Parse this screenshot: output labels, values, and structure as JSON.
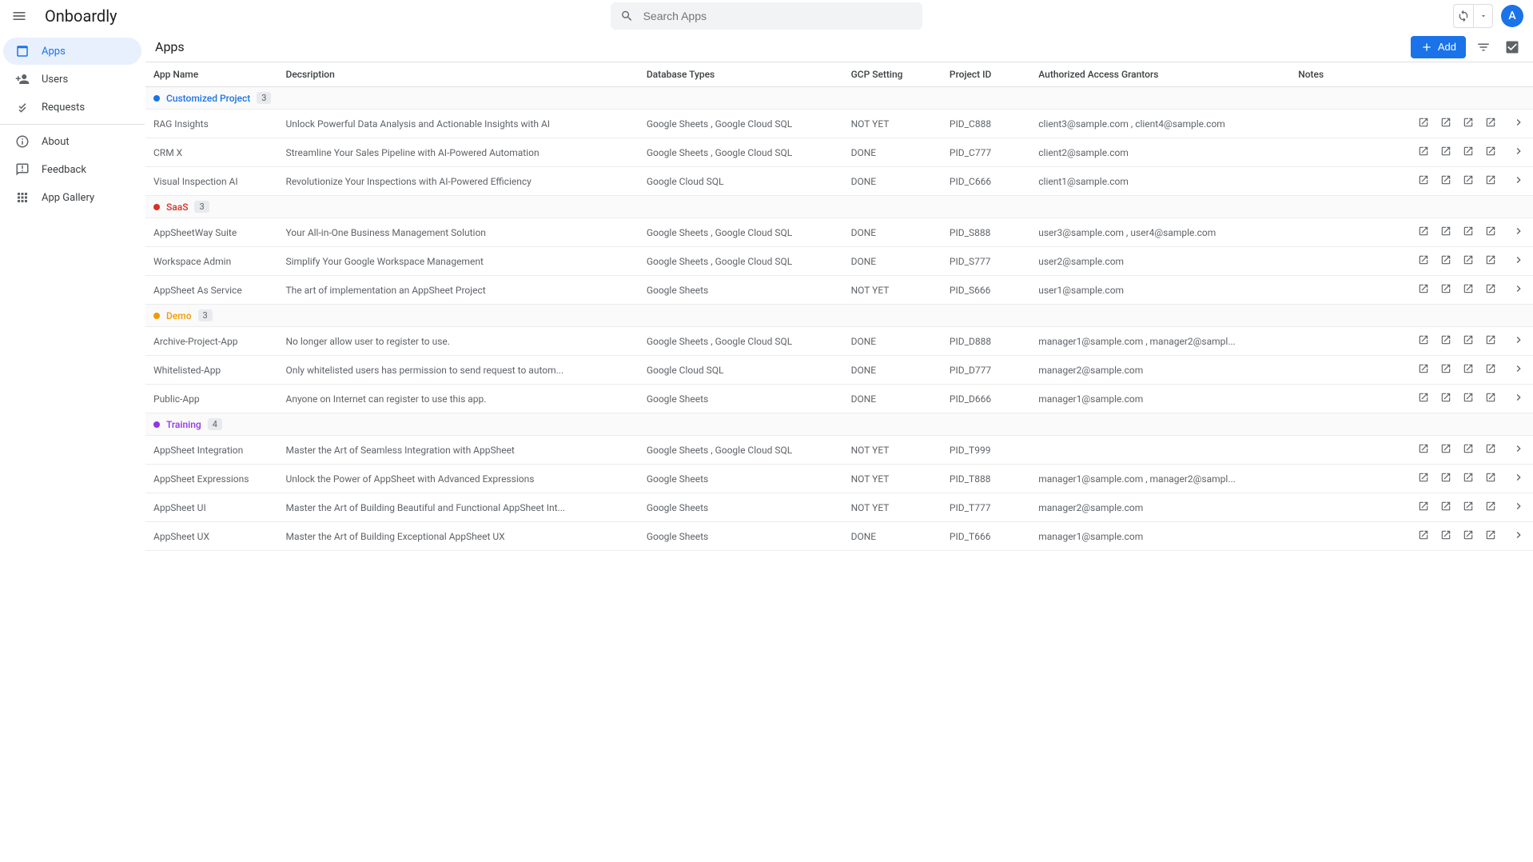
{
  "app_title": "Onboardly",
  "search_placeholder": "Search Apps",
  "avatar_initial": "A",
  "sidebar": [
    {
      "id": "apps",
      "label": "Apps",
      "active": true
    },
    {
      "id": "users",
      "label": "Users",
      "active": false
    },
    {
      "id": "requests",
      "label": "Requests",
      "active": false
    },
    {
      "id": "_divider"
    },
    {
      "id": "about",
      "label": "About",
      "active": false
    },
    {
      "id": "feedback",
      "label": "Feedback",
      "active": false
    },
    {
      "id": "app-gallery",
      "label": "App Gallery",
      "active": false
    }
  ],
  "page_title": "Apps",
  "add_button_label": "Add",
  "columns": {
    "app_name": "App Name",
    "description": "Decsription",
    "database_types": "Database Types",
    "gcp_setting": "GCP Setting",
    "project_id": "Project ID",
    "grantors": "Authorized Access Grantors",
    "notes": "Notes"
  },
  "groups": [
    {
      "label": "Customized Project",
      "color": "#1a73e8",
      "text_color": "#1a73e8",
      "count": "3",
      "rows": [
        {
          "name": "RAG Insights",
          "desc": "Unlock Powerful Data Analysis and Actionable Insights with AI",
          "db": "Google Sheets , Google Cloud SQL",
          "gcp": "NOT YET",
          "pid": "PID_C888",
          "grantors": "client3@sample.com , client4@sample.com"
        },
        {
          "name": "CRM X",
          "desc": "Streamline Your Sales Pipeline with AI-Powered Automation",
          "db": "Google Sheets , Google Cloud SQL",
          "gcp": "DONE",
          "pid": "PID_C777",
          "grantors": "client2@sample.com"
        },
        {
          "name": "Visual Inspection AI",
          "desc": "Revolutionize Your Inspections with AI-Powered Efficiency",
          "db": "Google Cloud SQL",
          "gcp": "DONE",
          "pid": "PID_C666",
          "grantors": "client1@sample.com"
        }
      ]
    },
    {
      "label": "SaaS",
      "color": "#d93025",
      "text_color": "#d93025",
      "count": "3",
      "rows": [
        {
          "name": "AppSheetWay Suite",
          "desc": "Your All-in-One Business Management Solution",
          "db": "Google Sheets , Google Cloud SQL",
          "gcp": "DONE",
          "pid": "PID_S888",
          "grantors": "user3@sample.com , user4@sample.com"
        },
        {
          "name": "Workspace Admin",
          "desc": "Simplify Your Google Workspace Management",
          "db": "Google Sheets , Google Cloud SQL",
          "gcp": "DONE",
          "pid": "PID_S777",
          "grantors": "user2@sample.com"
        },
        {
          "name": "AppSheet As Service",
          "desc": "The art of implementation an AppSheet Project",
          "db": "Google Sheets",
          "gcp": "NOT YET",
          "pid": "PID_S666",
          "grantors": "user1@sample.com"
        }
      ]
    },
    {
      "label": "Demo",
      "color": "#f29900",
      "text_color": "#f29900",
      "count": "3",
      "rows": [
        {
          "name": "Archive-Project-App",
          "desc": "No longer allow user to register to use.",
          "db": "Google Sheets , Google Cloud SQL",
          "gcp": "DONE",
          "pid": "PID_D888",
          "grantors": "manager1@sample.com , manager2@sampl..."
        },
        {
          "name": "Whitelisted-App",
          "desc": "Only whitelisted users has permission to send request to autom...",
          "db": "Google Cloud SQL",
          "gcp": "DONE",
          "pid": "PID_D777",
          "grantors": "manager2@sample.com"
        },
        {
          "name": "Public-App",
          "desc": "Anyone on Internet can register to use this app.",
          "db": "Google Sheets",
          "gcp": "DONE",
          "pid": "PID_D666",
          "grantors": "manager1@sample.com"
        }
      ]
    },
    {
      "label": "Training",
      "color": "#9334e6",
      "text_color": "#9334e6",
      "count": "4",
      "rows": [
        {
          "name": "AppSheet Integration",
          "desc": "Master the Art of Seamless Integration with AppSheet",
          "db": "Google Sheets , Google Cloud SQL",
          "gcp": "NOT YET",
          "pid": "PID_T999",
          "grantors": ""
        },
        {
          "name": "AppSheet Expressions",
          "desc": "Unlock the Power of AppSheet with Advanced Expressions",
          "db": "Google Sheets",
          "gcp": "NOT YET",
          "pid": "PID_T888",
          "grantors": "manager1@sample.com , manager2@sampl..."
        },
        {
          "name": "AppSheet UI",
          "desc": "Master the Art of Building Beautiful and Functional AppSheet Int...",
          "db": "Google Sheets",
          "gcp": "NOT YET",
          "pid": "PID_T777",
          "grantors": "manager2@sample.com"
        },
        {
          "name": "AppSheet UX",
          "desc": "Master the Art of Building Exceptional AppSheet UX",
          "db": "Google Sheets",
          "gcp": "DONE",
          "pid": "PID_T666",
          "grantors": "manager1@sample.com"
        }
      ]
    }
  ]
}
